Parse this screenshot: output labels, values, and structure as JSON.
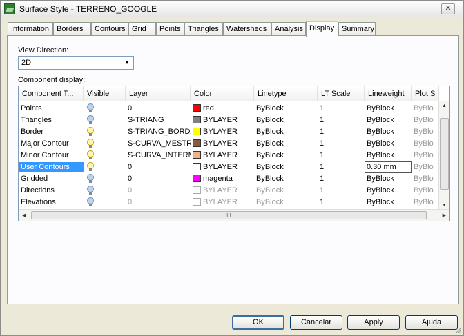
{
  "window": {
    "title": "Surface Style - TERRENO_GOOGLE",
    "close_glyph": "✕"
  },
  "tabs": [
    {
      "label": "Information"
    },
    {
      "label": "Borders"
    },
    {
      "label": "Contours"
    },
    {
      "label": "Grid"
    },
    {
      "label": "Points"
    },
    {
      "label": "Triangles"
    },
    {
      "label": "Watersheds"
    },
    {
      "label": "Analysis"
    },
    {
      "label": "Display",
      "active": true
    },
    {
      "label": "Summary"
    }
  ],
  "view_direction": {
    "label": "View Direction:",
    "value": "2D"
  },
  "component_display": {
    "label": "Component display:",
    "columns": [
      "Component T...",
      "Visible",
      "Layer",
      "Color",
      "Linetype",
      "LT Scale",
      "Lineweight",
      "Plot S"
    ],
    "rows": [
      {
        "component": "Points",
        "visible": false,
        "layer": "0",
        "color": "red",
        "swatch": "#ff0000",
        "linetype": "ByBlock",
        "lt_scale": "1",
        "lineweight": "ByBlock",
        "plot": "ByBlo"
      },
      {
        "component": "Triangles",
        "visible": false,
        "layer": "S-TRIANG",
        "color": "BYLAYER",
        "swatch": "#808080",
        "linetype": "ByBlock",
        "lt_scale": "1",
        "lineweight": "ByBlock",
        "plot": "ByBlo"
      },
      {
        "component": "Border",
        "visible": true,
        "layer": "S-TRIANG_BORDA",
        "color": "BYLAYER",
        "swatch": "#ffff00",
        "linetype": "ByBlock",
        "lt_scale": "1",
        "lineweight": "ByBlock",
        "plot": "ByBlo"
      },
      {
        "component": "Major Contour",
        "visible": true,
        "layer": "S-CURVA_MESTRA",
        "color": "BYLAYER",
        "swatch": "#8b5a3c",
        "linetype": "ByBlock",
        "lt_scale": "1",
        "lineweight": "ByBlock",
        "plot": "ByBlo"
      },
      {
        "component": "Minor Contour",
        "visible": true,
        "layer": "S-CURVA_INTERM",
        "color": "BYLAYER",
        "swatch": "#f4b183",
        "linetype": "ByBlock",
        "lt_scale": "1",
        "lineweight": "ByBlock",
        "plot": "ByBlo"
      },
      {
        "component": "User Contours",
        "visible": true,
        "selected": true,
        "layer": "0",
        "color": "BYLAYER",
        "swatch": "#ffffff",
        "linetype": "ByBlock",
        "lt_scale": "1",
        "lineweight": "0.30 mm",
        "lineweight_edit": true,
        "plot": "ByBlo"
      },
      {
        "component": "Gridded",
        "visible": false,
        "layer": "0",
        "color": "magenta",
        "swatch": "#ff00ff",
        "linetype": "ByBlock",
        "lt_scale": "1",
        "lineweight": "ByBlock",
        "plot": "ByBlo"
      },
      {
        "component": "Directions",
        "visible": false,
        "dim": true,
        "layer": "0",
        "color": "BYLAYER",
        "swatch": "#ffffff",
        "linetype": "ByBlock",
        "lt_scale": "1",
        "lineweight": "ByBlock",
        "plot": "ByBlo"
      },
      {
        "component": "Elevations",
        "visible": false,
        "dim": true,
        "layer": "0",
        "color": "BYLAYER",
        "swatch": "#ffffff",
        "linetype": "ByBlock",
        "lt_scale": "1",
        "lineweight": "ByBlock",
        "plot": "ByBlo"
      }
    ],
    "hscroll_thumb": "III"
  },
  "buttons": {
    "ok": "OK",
    "cancel": "Cancelar",
    "apply": "Apply",
    "help": "Ajuda"
  },
  "colors": {
    "accent": "#3399ff",
    "tab_highlight": "#ffc83c"
  },
  "icons": [
    "surface-style-icon",
    "lightbulb-icon",
    "chevron-down-icon",
    "close-icon"
  ]
}
